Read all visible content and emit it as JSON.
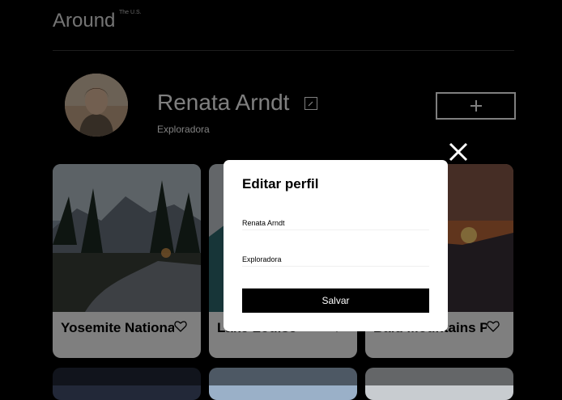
{
  "header": {
    "logo": "Around",
    "logo_sup": "The U.S."
  },
  "profile": {
    "name": "Renata Arndt",
    "role": "Exploradora"
  },
  "cards": [
    {
      "title": "Yosemite National Park"
    },
    {
      "title": "Lake Louise"
    },
    {
      "title": "Bald Mountains Park"
    }
  ],
  "modal": {
    "title": "Editar perfil",
    "name_value": "Renata Arndt",
    "role_value": "Exploradora",
    "save_label": "Salvar"
  },
  "icons": {
    "edit": "pencil-icon",
    "add": "plus-icon",
    "like": "heart-icon",
    "close": "close-icon"
  }
}
